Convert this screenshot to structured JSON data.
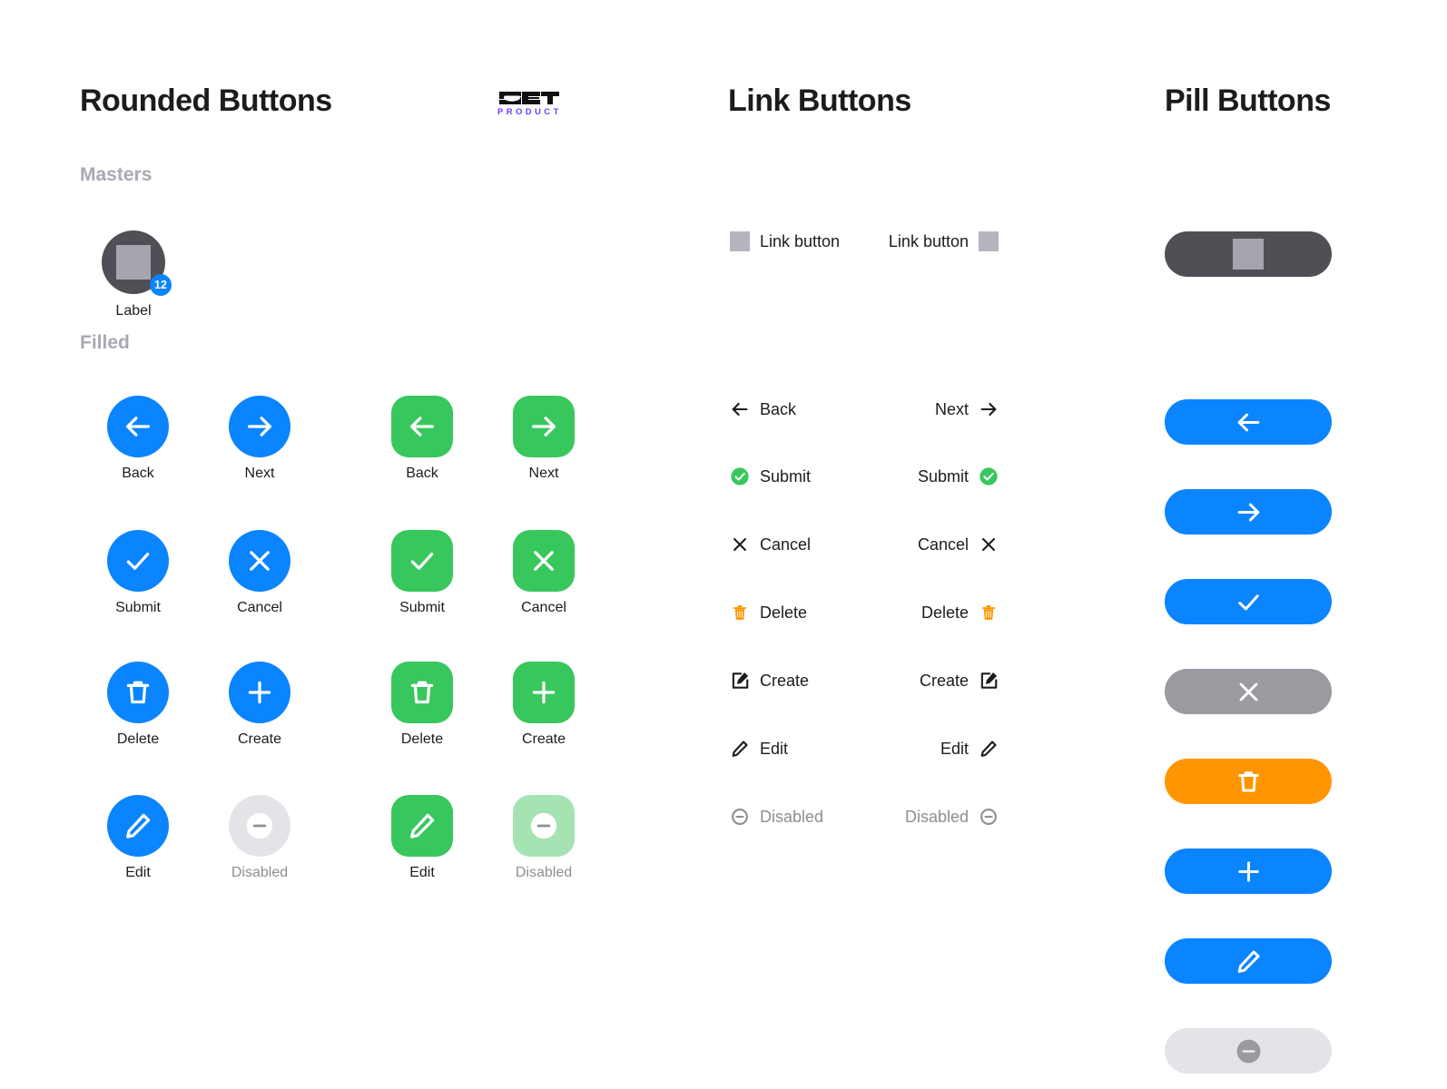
{
  "brand": {
    "logo_text": "SET",
    "logo_sub": "PRODUCT",
    "logo_accent": "#6c3cff"
  },
  "colors": {
    "blue": "#0a84ff",
    "green": "#38c75d",
    "orange": "#ff9500",
    "gray": "#9a9aa0",
    "dark": "#4f4f55",
    "disabled_light": "#e5e3e8",
    "disabled_green": "#a5e3b3",
    "placeholder": "#a5a5b0",
    "muted_text": "#8e8e93",
    "section_label": "#a7a9b4"
  },
  "columns": {
    "rounded": {
      "title": "Rounded Buttons"
    },
    "link": {
      "title": "Link Buttons"
    },
    "pill": {
      "title": "Pill Buttons"
    }
  },
  "sections": {
    "masters_label": "Masters",
    "filled_label": "Filled"
  },
  "master": {
    "label": "Label",
    "badge_count": "12",
    "icon": "placeholder-square-icon"
  },
  "filled_buttons": {
    "blue_column": [
      {
        "caption": "Back",
        "icon": "arrow-left-icon",
        "color": "#0a84ff",
        "shape": "circle",
        "state": "enabled"
      },
      {
        "caption": "Submit",
        "icon": "check-icon",
        "color": "#0a84ff",
        "shape": "circle",
        "state": "enabled"
      },
      {
        "caption": "Delete",
        "icon": "trash-icon",
        "color": "#0a84ff",
        "shape": "circle",
        "state": "enabled"
      },
      {
        "caption": "Edit",
        "icon": "pencil-icon",
        "color": "#0a84ff",
        "shape": "circle",
        "state": "enabled"
      }
    ],
    "blue_column_2": [
      {
        "caption": "Next",
        "icon": "arrow-right-icon",
        "color": "#0a84ff",
        "shape": "circle",
        "state": "enabled"
      },
      {
        "caption": "Cancel",
        "icon": "close-icon",
        "color": "#0a84ff",
        "shape": "circle",
        "state": "enabled"
      },
      {
        "caption": "Create",
        "icon": "plus-icon",
        "color": "#0a84ff",
        "shape": "circle",
        "state": "enabled"
      },
      {
        "caption": "Disabled",
        "icon": "minus-circle-icon",
        "color": "#e5e3e8",
        "shape": "circle",
        "state": "disabled"
      }
    ],
    "green_column": [
      {
        "caption": "Back",
        "icon": "arrow-left-icon",
        "color": "#38c75d",
        "shape": "rounded",
        "state": "enabled"
      },
      {
        "caption": "Submit",
        "icon": "check-icon",
        "color": "#38c75d",
        "shape": "rounded",
        "state": "enabled"
      },
      {
        "caption": "Delete",
        "icon": "trash-icon",
        "color": "#38c75d",
        "shape": "rounded",
        "state": "enabled"
      },
      {
        "caption": "Edit",
        "icon": "pencil-icon",
        "color": "#38c75d",
        "shape": "rounded",
        "state": "enabled"
      }
    ],
    "green_column_2": [
      {
        "caption": "Next",
        "icon": "arrow-right-icon",
        "color": "#38c75d",
        "shape": "rounded",
        "state": "enabled"
      },
      {
        "caption": "Cancel",
        "icon": "close-icon",
        "color": "#38c75d",
        "shape": "rounded",
        "state": "enabled"
      },
      {
        "caption": "Create",
        "icon": "plus-icon",
        "color": "#38c75d",
        "shape": "rounded",
        "state": "enabled"
      },
      {
        "caption": "Disabled",
        "icon": "minus-circle-icon",
        "color": "#a5e3b3",
        "shape": "rounded",
        "state": "disabled"
      }
    ]
  },
  "link_master": {
    "left_label": "Link button",
    "right_label": "Link button",
    "icon": "placeholder-square-icon"
  },
  "link_buttons_left": [
    {
      "label": "Back",
      "icon": "arrow-left-icon",
      "state": "enabled"
    },
    {
      "label": "Submit",
      "icon": "check-circle-green-icon",
      "state": "enabled"
    },
    {
      "label": "Cancel",
      "icon": "close-icon",
      "state": "enabled"
    },
    {
      "label": "Delete",
      "icon": "trash-orange-icon",
      "state": "enabled"
    },
    {
      "label": "Create",
      "icon": "create-square-icon",
      "state": "enabled"
    },
    {
      "label": "Edit",
      "icon": "pencil-icon",
      "state": "enabled"
    },
    {
      "label": "Disabled",
      "icon": "minus-circle-icon",
      "state": "disabled"
    }
  ],
  "link_buttons_right": [
    {
      "label": "Next",
      "icon": "arrow-right-icon",
      "state": "enabled"
    },
    {
      "label": "Submit",
      "icon": "check-circle-green-icon",
      "state": "enabled"
    },
    {
      "label": "Cancel",
      "icon": "close-icon",
      "state": "enabled"
    },
    {
      "label": "Delete",
      "icon": "trash-orange-icon",
      "state": "enabled"
    },
    {
      "label": "Create",
      "icon": "create-square-icon",
      "state": "enabled"
    },
    {
      "label": "Edit",
      "icon": "pencil-icon",
      "state": "enabled"
    },
    {
      "label": "Disabled",
      "icon": "minus-circle-icon",
      "state": "disabled"
    }
  ],
  "pill_master": {
    "icon": "placeholder-square-icon",
    "color": "#4f4f55"
  },
  "pill_buttons": [
    {
      "icon": "arrow-left-icon",
      "color": "#0a84ff",
      "state": "enabled",
      "name": "back"
    },
    {
      "icon": "arrow-right-icon",
      "color": "#0a84ff",
      "state": "enabled",
      "name": "next"
    },
    {
      "icon": "check-icon",
      "color": "#0a84ff",
      "state": "enabled",
      "name": "submit"
    },
    {
      "icon": "close-icon",
      "color": "#9a9aa0",
      "state": "enabled",
      "name": "cancel"
    },
    {
      "icon": "trash-icon",
      "color": "#ff9500",
      "state": "enabled",
      "name": "delete"
    },
    {
      "icon": "plus-icon",
      "color": "#0a84ff",
      "state": "enabled",
      "name": "create"
    },
    {
      "icon": "pencil-icon",
      "color": "#0a84ff",
      "state": "enabled",
      "name": "edit"
    },
    {
      "icon": "minus-circle-icon",
      "color": "#e5e3e8",
      "state": "disabled",
      "name": "disabled"
    }
  ]
}
